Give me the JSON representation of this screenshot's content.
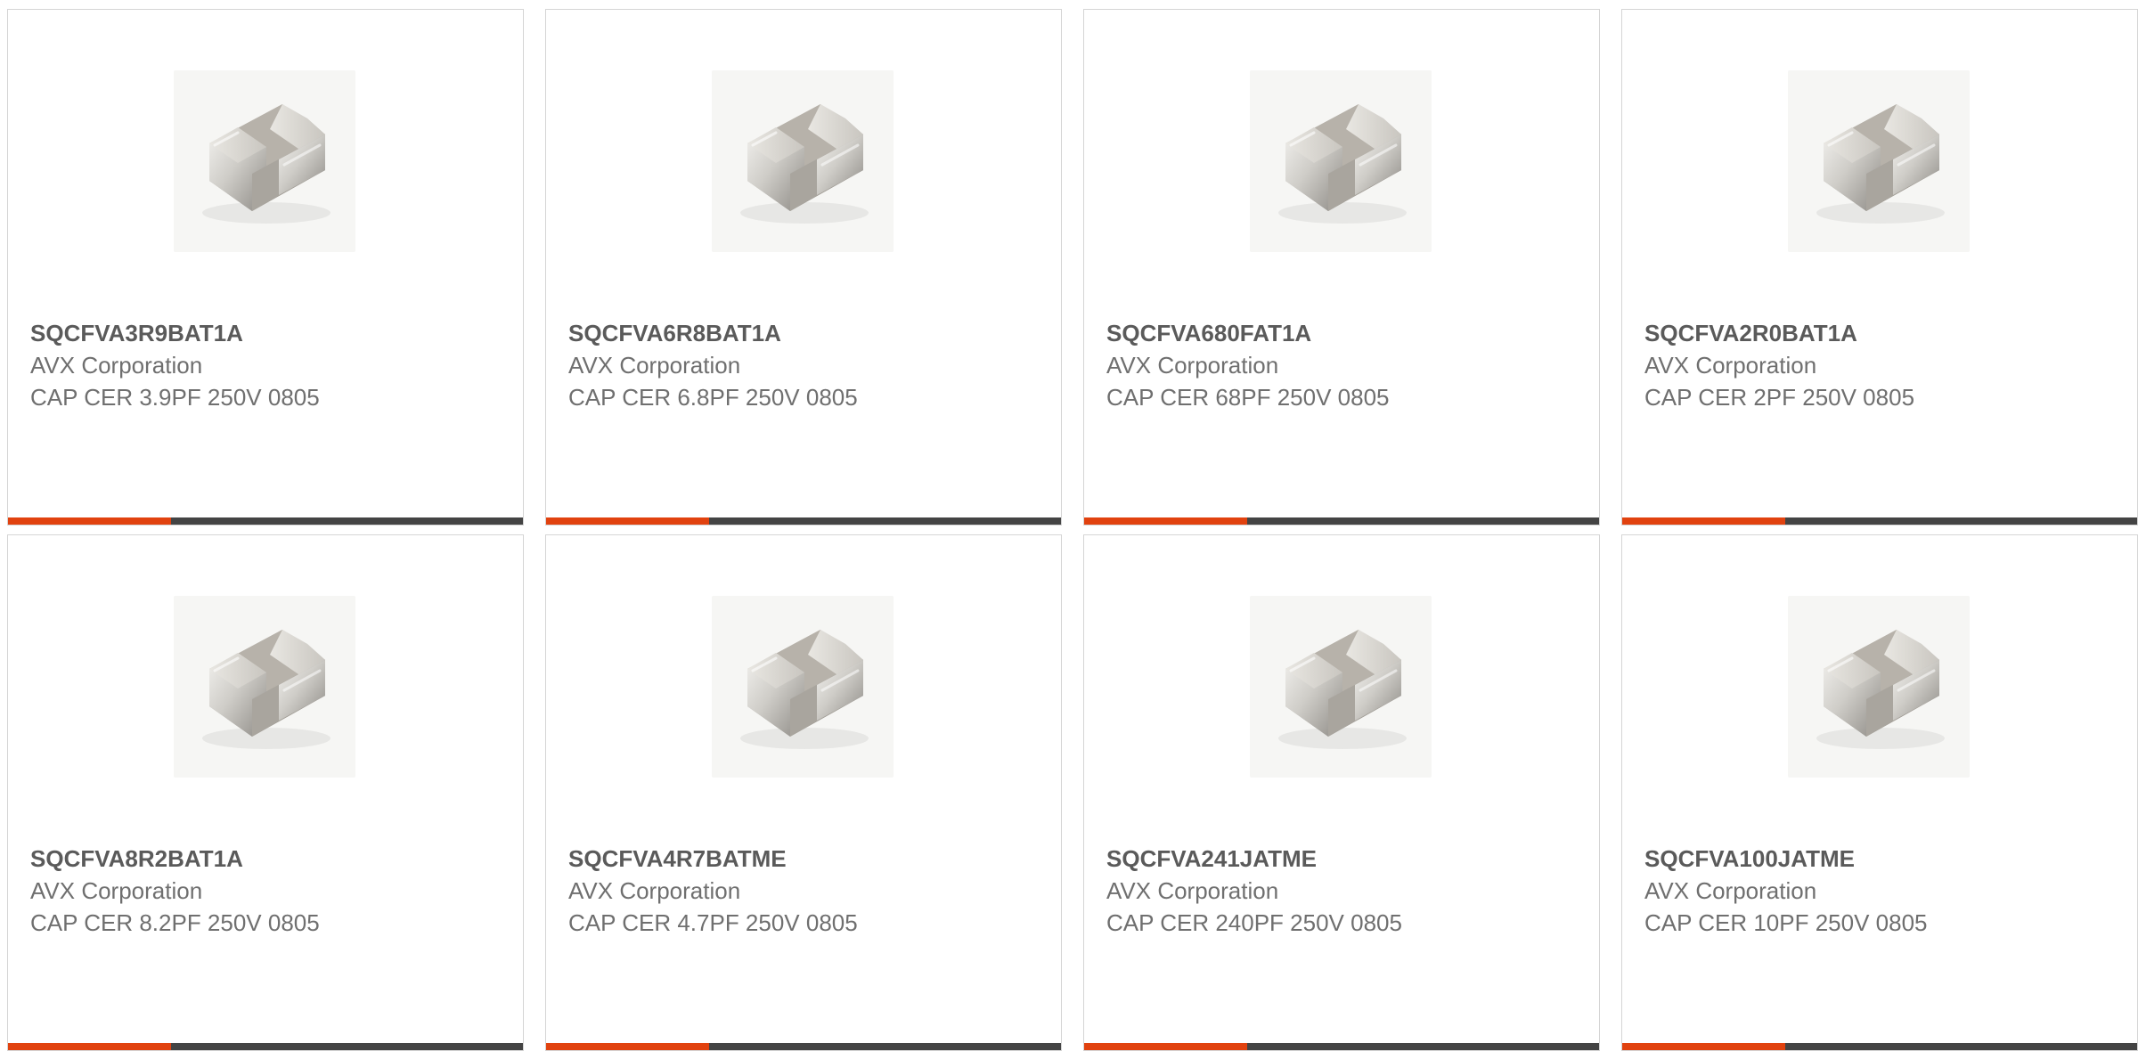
{
  "colors": {
    "accent": "#e1420f",
    "dark": "#444444",
    "card_border": "#d5d5d5"
  },
  "products": [
    {
      "part": "SQCFVA3R9BAT1A",
      "manufacturer": "AVX Corporation",
      "description": "CAP CER 3.9PF 250V 0805",
      "image_icon": "capacitor-chip-image"
    },
    {
      "part": "SQCFVA6R8BAT1A",
      "manufacturer": "AVX Corporation",
      "description": "CAP CER 6.8PF 250V 0805",
      "image_icon": "capacitor-chip-image"
    },
    {
      "part": "SQCFVA680FAT1A",
      "manufacturer": "AVX Corporation",
      "description": "CAP CER 68PF 250V 0805",
      "image_icon": "capacitor-chip-image"
    },
    {
      "part": "SQCFVA2R0BAT1A",
      "manufacturer": "AVX Corporation",
      "description": "CAP CER 2PF 250V 0805",
      "image_icon": "capacitor-chip-image"
    },
    {
      "part": "SQCFVA8R2BAT1A",
      "manufacturer": "AVX Corporation",
      "description": "CAP CER 8.2PF 250V 0805",
      "image_icon": "capacitor-chip-image"
    },
    {
      "part": "SQCFVA4R7BATME",
      "manufacturer": "AVX Corporation",
      "description": "CAP CER 4.7PF 250V 0805",
      "image_icon": "capacitor-chip-image"
    },
    {
      "part": "SQCFVA241JATME",
      "manufacturer": "AVX Corporation",
      "description": "CAP CER 240PF 250V 0805",
      "image_icon": "capacitor-chip-image"
    },
    {
      "part": "SQCFVA100JATME",
      "manufacturer": "AVX Corporation",
      "description": "CAP CER 10PF 250V 0805",
      "image_icon": "capacitor-chip-image"
    }
  ]
}
